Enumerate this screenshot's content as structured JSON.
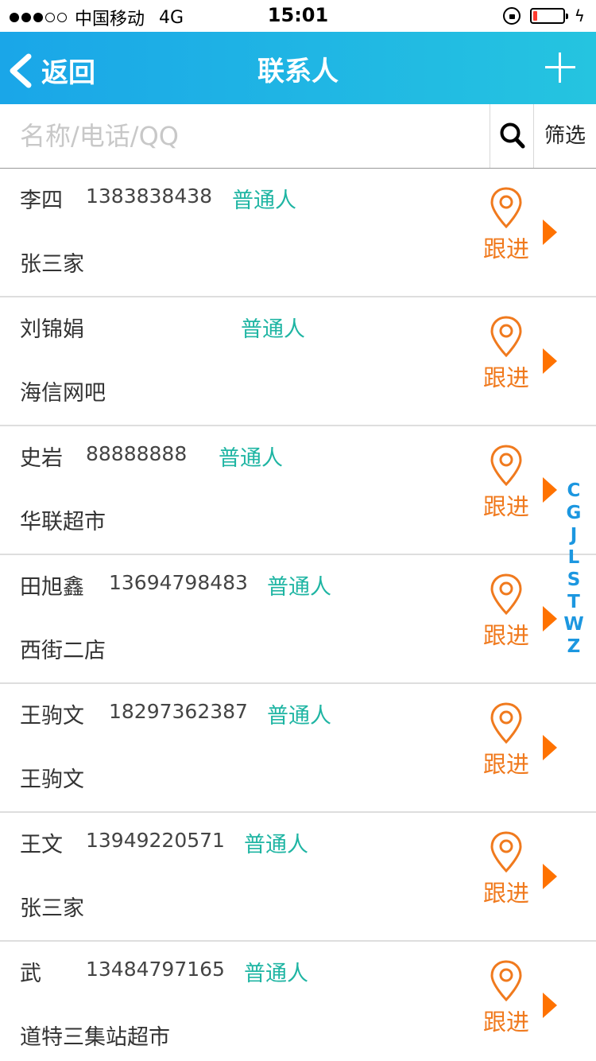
{
  "status_bar": {
    "carrier": "中国移动",
    "network": "4G",
    "time": "15:01",
    "battery_level": 0.15
  },
  "nav": {
    "back_label": "返回",
    "title": "联系人"
  },
  "search": {
    "placeholder": "名称/电话/QQ",
    "filter_label": "筛选"
  },
  "follow_label": "跟进",
  "contacts": [
    {
      "name": "李四",
      "phone": "1383838438",
      "tag": "普通人",
      "company": "张三家"
    },
    {
      "name": "刘锦娟",
      "phone": "",
      "tag": "普通人",
      "company": "海信网吧"
    },
    {
      "name": "史岩",
      "phone": "88888888",
      "tag": "普通人",
      "company": "华联超市"
    },
    {
      "name": "田旭鑫",
      "phone": "13694798483",
      "tag": "普通人",
      "company": "西街二店"
    },
    {
      "name": "王驹文",
      "phone": "18297362387",
      "tag": "普通人",
      "company": "王驹文"
    },
    {
      "name": "王文",
      "phone": "13949220571",
      "tag": "普通人",
      "company": "张三家"
    },
    {
      "name": "武",
      "phone": "13484797165",
      "tag": "普通人",
      "company": "道特三集站超市"
    }
  ],
  "index_letters": [
    "C",
    "G",
    "J",
    "L",
    "S",
    "T",
    "W",
    "Z"
  ],
  "colors": {
    "nav_gradient_start": "#1aa6e8",
    "nav_gradient_end": "#25c4e0",
    "tag": "#1fb5a3",
    "follow": "#f07a1e",
    "arrow": "#ff7200",
    "index": "#1c97e0"
  }
}
